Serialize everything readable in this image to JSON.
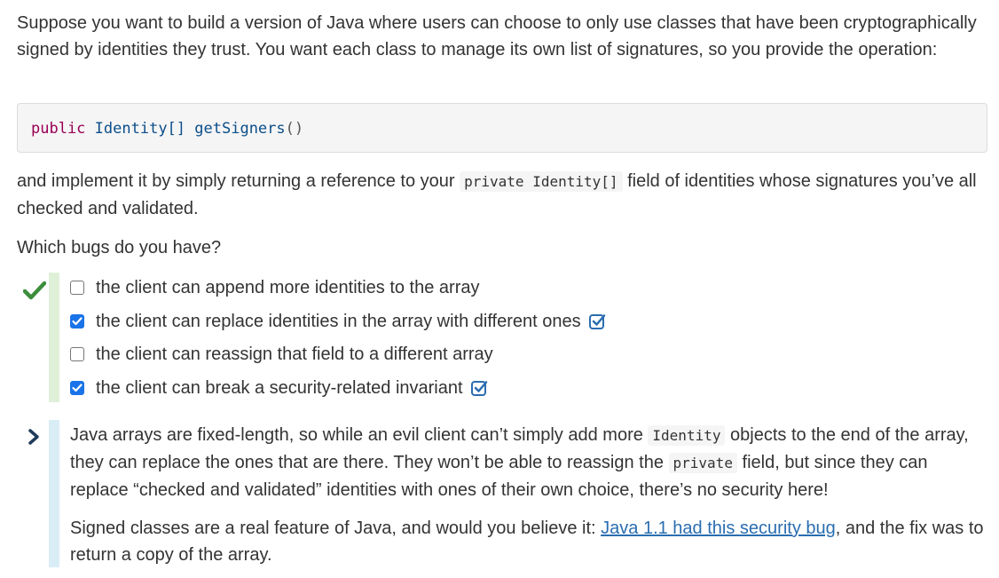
{
  "question": {
    "intro": "Suppose you want to build a version of Java where users can choose to only use classes that have been cryptographically signed by identities they trust. You want each class to manage its own list of signatures, so you provide the operation:",
    "code": {
      "kw": "public",
      "type": "Identity[]",
      "method": "getSigners",
      "parens": "()"
    },
    "after_code_1": "and implement it by simply returning a reference to your ",
    "after_code_inline": "private Identity[]",
    "after_code_2": " field of identities whose signatures you’ve all checked and validated.",
    "prompt": "Which bugs do you have?"
  },
  "result_icon": "green-checkmark-icon",
  "options": [
    {
      "label": "the client can append more identities to the array",
      "checked": false
    },
    {
      "label": "the client can replace identities in the array with different ones",
      "checked": true
    },
    {
      "label": "the client can reassign that field to a different array",
      "checked": false
    },
    {
      "label": "the client can break a security-related invariant",
      "checked": true
    }
  ],
  "explanation": {
    "p1_a": "Java arrays are fixed-length, so while an evil client can’t simply add more ",
    "p1_code1": "Identity",
    "p1_b": " objects to the end of the array, they can replace the ones that are there. They won’t be able to reassign the ",
    "p1_code2": "private",
    "p1_c": " field, but since they can replace “checked and validated” identities with ones of their own choice, there’s no security here!",
    "p2_a": "Signed classes are a real feature of Java, and would you believe it: ",
    "p2_link": "Java 1.1 had this security bug",
    "p2_b": ", and the fix was to return a copy of the array."
  },
  "colors": {
    "correct_bar": "#dff0d8",
    "explanation_bar": "#d9edf7",
    "checkbox_checked": "#1a73e8",
    "link": "#2a6db0"
  }
}
